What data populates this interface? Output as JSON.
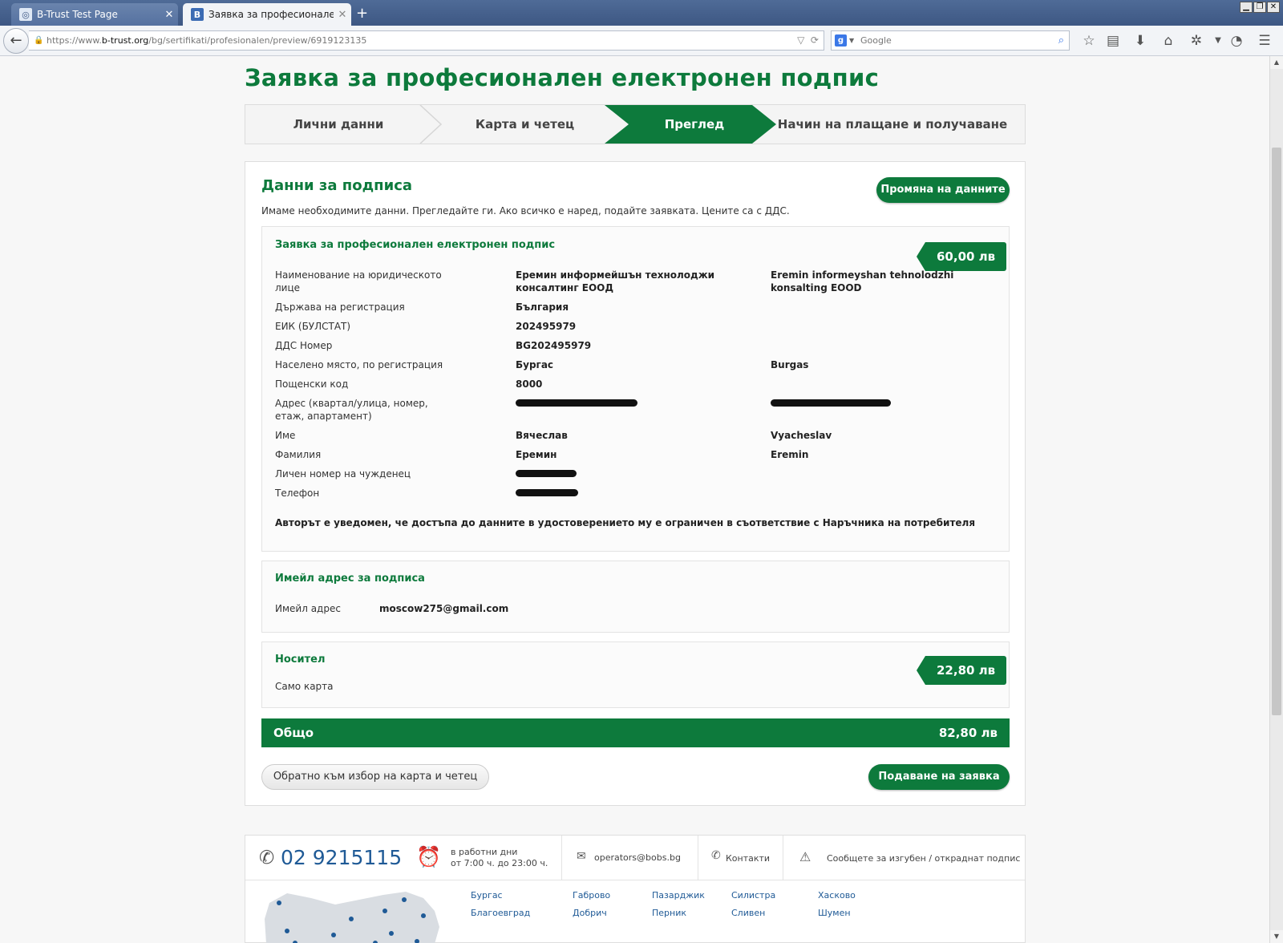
{
  "browser": {
    "tabs": [
      {
        "title": "B-Trust Test Page",
        "favicon": "globe-icon"
      },
      {
        "title": "Заявка за професионален е...",
        "favicon": "B"
      }
    ],
    "url": {
      "prefix": "https://www.",
      "domain": "b-trust.org",
      "path": "/bg/sertifikati/profesionalen/preview/6919123135"
    },
    "search_placeholder": "Google",
    "search_logo": "g",
    "new_tab": "+",
    "tab_close": "✕"
  },
  "page": {
    "title": "Заявка за професионален електронен подпис",
    "steps": [
      {
        "label": "Лични данни",
        "active": false
      },
      {
        "label": "Карта и четец",
        "active": false
      },
      {
        "label": "Преглед",
        "active": true
      },
      {
        "label": "Начин на плащане и получаване",
        "active": false
      }
    ]
  },
  "review": {
    "heading": "Данни за подписа",
    "change_button": "Промяна на данните",
    "intro": "Имаме необходимите данни. Прегледайте ги. Ако всичко е наред, подайте заявката. Цените са с ДДС.",
    "signature_panel": {
      "title": "Заявка за професионален електронен подпис",
      "price": "60,00 лв",
      "rows": [
        {
          "label": "Наименование на юридическото лице",
          "value_bg": "Еремин информейшън технолоджи консалтинг ЕООД",
          "value_en": "Eremin informeyshan tehnolodzhi konsalting EOOD"
        },
        {
          "label": "Държава на регистрация",
          "value_bg": "България",
          "value_en": ""
        },
        {
          "label": "ЕИК (БУЛСТАТ)",
          "value_bg": "202495979",
          "value_en": ""
        },
        {
          "label": "ДДС Номер",
          "value_bg": "BG202495979",
          "value_en": ""
        },
        {
          "label": "Населено място, по регистрация",
          "value_bg": "Бургас",
          "value_en": "Burgas"
        },
        {
          "label": "Пощенски код",
          "value_bg": "8000",
          "value_en": ""
        },
        {
          "label": "Адрес (квартал/улица, номер, етаж, апартамент)",
          "value_bg": "",
          "value_en": ""
        },
        {
          "label": "Име",
          "value_bg": "Вячеслав",
          "value_en": "Vyacheslav"
        },
        {
          "label": "Фамилия",
          "value_bg": "Еремин",
          "value_en": "Eremin"
        },
        {
          "label": "Личен номер на чужденец",
          "value_bg": "",
          "value_en": ""
        },
        {
          "label": "Телефон",
          "value_bg": "",
          "value_en": ""
        }
      ],
      "notice": "Авторът е уведомен, че достъпа до данните в удостоверението му е ограничен в съответствие с Наръчника на потребителя"
    },
    "email_panel": {
      "title": "Имейл адрес за подписа",
      "label": "Имейл адрес",
      "value": "moscow275@gmail.com"
    },
    "carrier_panel": {
      "title": "Носител",
      "value": "Само карта",
      "price": "22,80 лв"
    },
    "total": {
      "label": "Общо",
      "value": "82,80 лв"
    },
    "back_button": "Обратно към избор на карта и четец",
    "submit_button": "Подаване на заявка"
  },
  "footer": {
    "phone": "02 9215115",
    "hours_line1": "в работни дни",
    "hours_line2": "от 7:00 ч. до 23:00 ч.",
    "email": "operators@bobs.bg",
    "contacts": "Контакти",
    "report": "Сообщете за изгубен / откраднат подпис",
    "cities": [
      [
        "Бургас",
        "Благоевград"
      ],
      [
        "Габрово",
        "Добрич"
      ],
      [
        "Пазарджик",
        "Перник"
      ],
      [
        "Силистра",
        "Сливен"
      ],
      [
        "Хасково",
        "Шумен"
      ]
    ]
  },
  "colors": {
    "brand_green": "#0d7a3c",
    "link_blue": "#1f5a96"
  }
}
